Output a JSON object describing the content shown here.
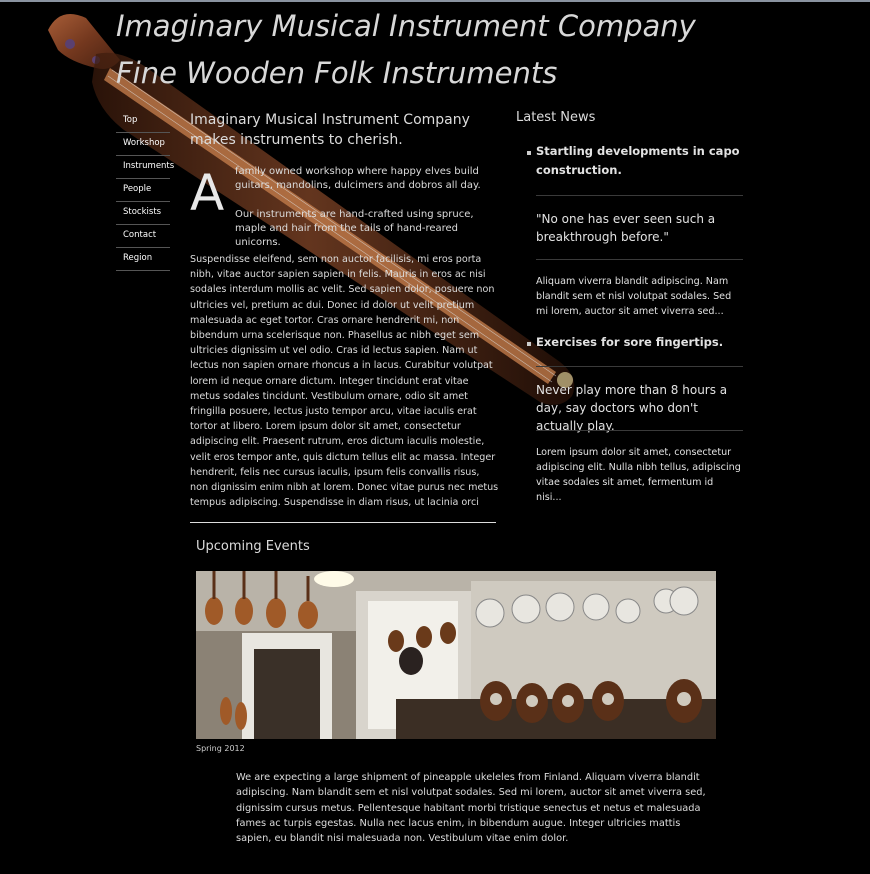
{
  "header": {
    "title_line1": "Imaginary Musical Instrument Company",
    "title_line2": "Fine Wooden Folk Instruments"
  },
  "nav": {
    "items": [
      {
        "label": "Top"
      },
      {
        "label": "Workshop"
      },
      {
        "label": "Instruments"
      },
      {
        "label": "People"
      },
      {
        "label": "Stockists"
      },
      {
        "label": "Contact"
      },
      {
        "label": "Region"
      }
    ]
  },
  "main": {
    "lead": "Imaginary Musical Instrument Company makes instruments to cherish.",
    "dropcap": "A",
    "intro_p1": "family owned workshop where happy elves build guitars, mandolins, dulcimers and dobros all day.",
    "intro_p2": "Our instruments are hand-crafted using spruce, maple and hair from the tails of hand-reared unicorns.",
    "body": "Suspendisse eleifend, sem non auctor facilisis, mi eros porta nibh, vitae auctor sapien sapien in felis. Mauris in eros ac nisi sodales interdum mollis ac velit. Sed sapien dolor, posuere non ultricies vel, pretium ac dui. Donec id dolor ut velit pretium malesuada ac eget tortor. Cras ornare hendrerit mi, non bibendum urna scelerisque non. Phasellus ac nibh eget sem ultricies dignissim ut vel odio. Cras id lectus sapien. Nam ut lectus non sapien ornare rhoncus a in lacus. Curabitur volutpat lorem id neque ornare dictum. Integer tincidunt erat vitae metus sodales tincidunt. Vestibulum ornare, odio sit amet fringilla posuere, lectus justo tempor arcu, vitae iaculis erat tortor at libero. Lorem ipsum dolor sit amet, consectetur adipiscing elit. Praesent rutrum, eros dictum iaculis molestie, velit eros tempor ante, quis dictum tellus elit ac massa. Integer hendrerit, felis nec cursus iaculis, ipsum felis convallis risus, non dignissim enim nibh at lorem. Donec vitae purus nec metus tempus adipiscing. Suspendisse in diam risus, ut lacinia orci"
  },
  "news": {
    "heading": "Latest News",
    "items": [
      {
        "title": "Startling developments in capo construction.",
        "quote": "\"No one has ever seen such a breakthrough before.\"",
        "text": "Aliquam viverra blandit adipiscing. Nam blandit sem et nisl volutpat sodales. Sed mi lorem, auctor sit amet viverra sed..."
      },
      {
        "title": "Exercises for sore fingertips.",
        "quote": "Never play more than 8 hours a day, say doctors who don't actually play.",
        "text": "Lorem ipsum dolor sit amet, consectetur adipiscing elit. Nulla nibh tellus, adipiscing vitae sodales sit amet, fermentum id nisi..."
      }
    ]
  },
  "events": {
    "heading": "Upcoming Events",
    "caption": "Spring 2012",
    "text": "We are expecting a large shipment of pineapple ukeleles from Finland. Aliquam viverra blandit adipiscing. Nam blandit sem et nisl volutpat sodales. Sed mi lorem, auctor sit amet viverra sed, dignissim cursus metus. Pellentesque habitant morbi tristique senectus et netus et malesuada fames ac turpis egestas. Nulla nec lacus enim, in bibendum augue. Integer ultricies mattis sapien, eu blandit nisi malesuada non. Vestibulum vitae enim dolor."
  },
  "colors": {
    "background": "#000000",
    "wood": "#8a4a2a",
    "text": "#dcdcdc"
  }
}
